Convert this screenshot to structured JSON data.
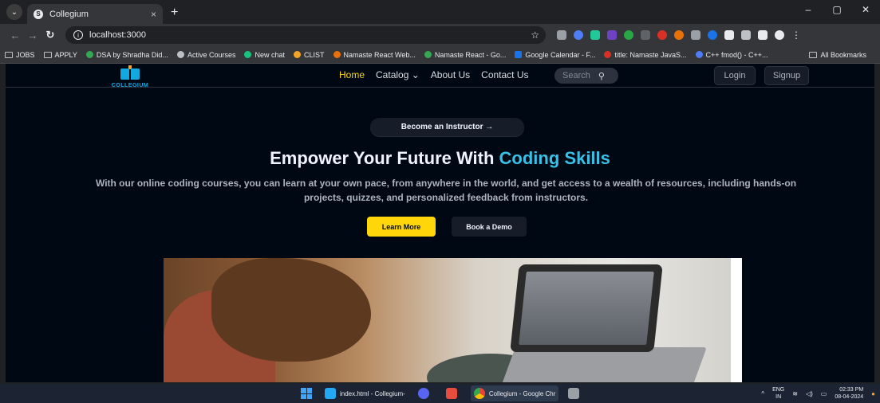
{
  "browser": {
    "tab_title": "Collegium",
    "tab_close": "×",
    "new_tab": "+",
    "url": "localhost:3000",
    "window_controls": [
      "–",
      "▢",
      "✕"
    ],
    "bookmarks": [
      "JOBS",
      "APPLY",
      "DSA by Shradha Did...",
      "Active Courses",
      "New chat",
      "CLIST",
      "Namaste React Web...",
      "Namaste React - Go...",
      "Google Calendar - F...",
      "title: Namaste JavaS...",
      "C++ fmod() - C++..."
    ],
    "all_bookmarks": "All Bookmarks"
  },
  "site": {
    "logo_text": "COLLEGIUM",
    "nav": {
      "home": "Home",
      "catalog": "Catalog",
      "about": "About Us",
      "contact": "Contact Us",
      "search_placeholder": "Search",
      "login": "Login",
      "signup": "Signup"
    },
    "instructor_button": "Become an Instructor",
    "headline_prefix": "Empower Your Future With",
    "headline_accent": "Coding Skills",
    "subtext": "With our online coding courses, you can learn at your own pace, from anywhere in the world, and get access to a wealth of resources, including hands-on projects, quizzes, and personalized feedback from instructors.",
    "learn_more": "Learn More",
    "book_demo": "Book a Demo",
    "colors": {
      "accent_yellow": "#ffd60a",
      "accent_blue": "#38c1e8",
      "page_bg": "#000814"
    }
  },
  "taskbar": {
    "apps": [
      "index.html - Collegium-",
      "Collegium - Google Chr"
    ],
    "lang_top": "ENG",
    "lang_bottom": "IN",
    "time": "02:33 PM",
    "date": "08-04-2024"
  }
}
